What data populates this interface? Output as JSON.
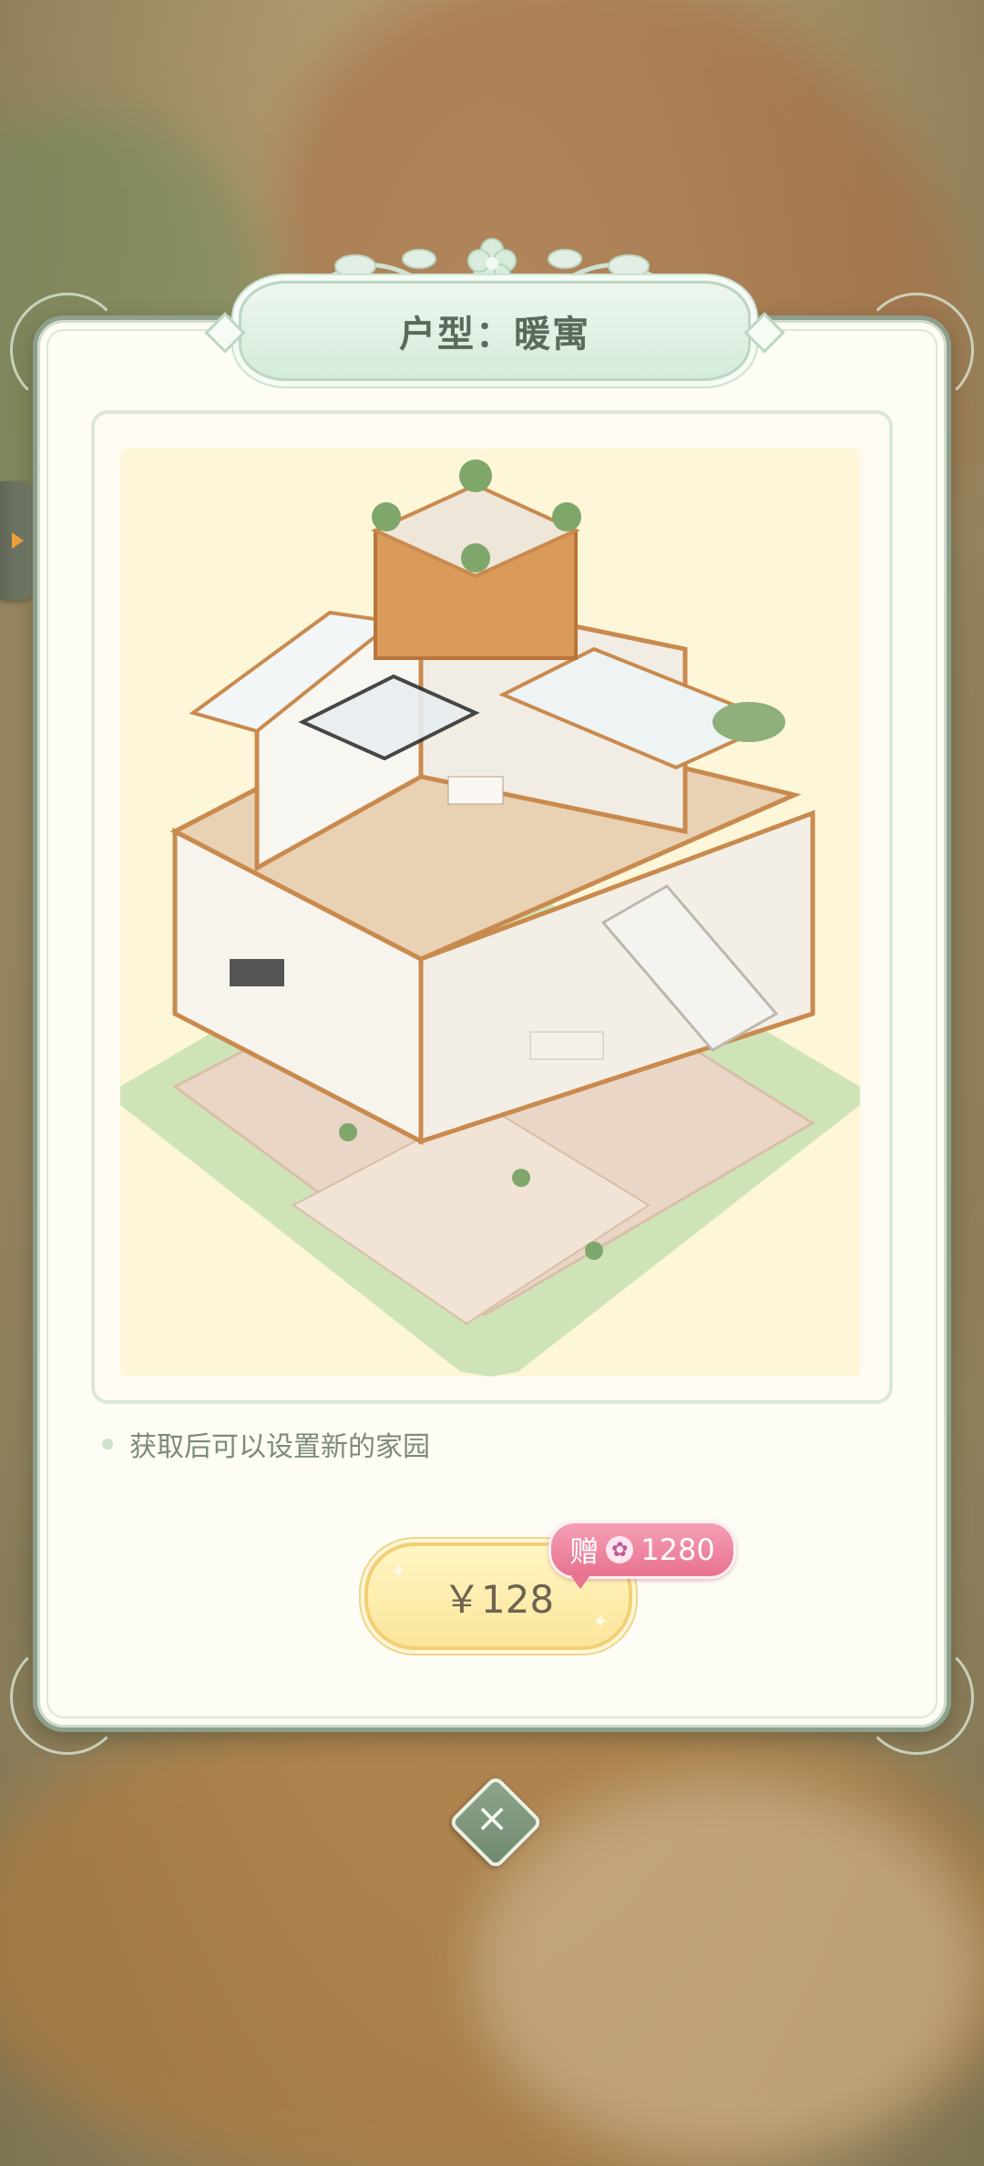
{
  "dialog": {
    "title": "户型：暖寓",
    "note": "获取后可以设置新的家园"
  },
  "purchase": {
    "price": "￥128",
    "bonus_label": "赠",
    "bonus_amount": "1280",
    "bonus_icon": "star-gem-icon"
  },
  "colors": {
    "panel_border": "#8e9f8c",
    "title_text": "#5a6a5c",
    "price_button": "#fbe59a",
    "bonus_badge": "#e8728f"
  }
}
